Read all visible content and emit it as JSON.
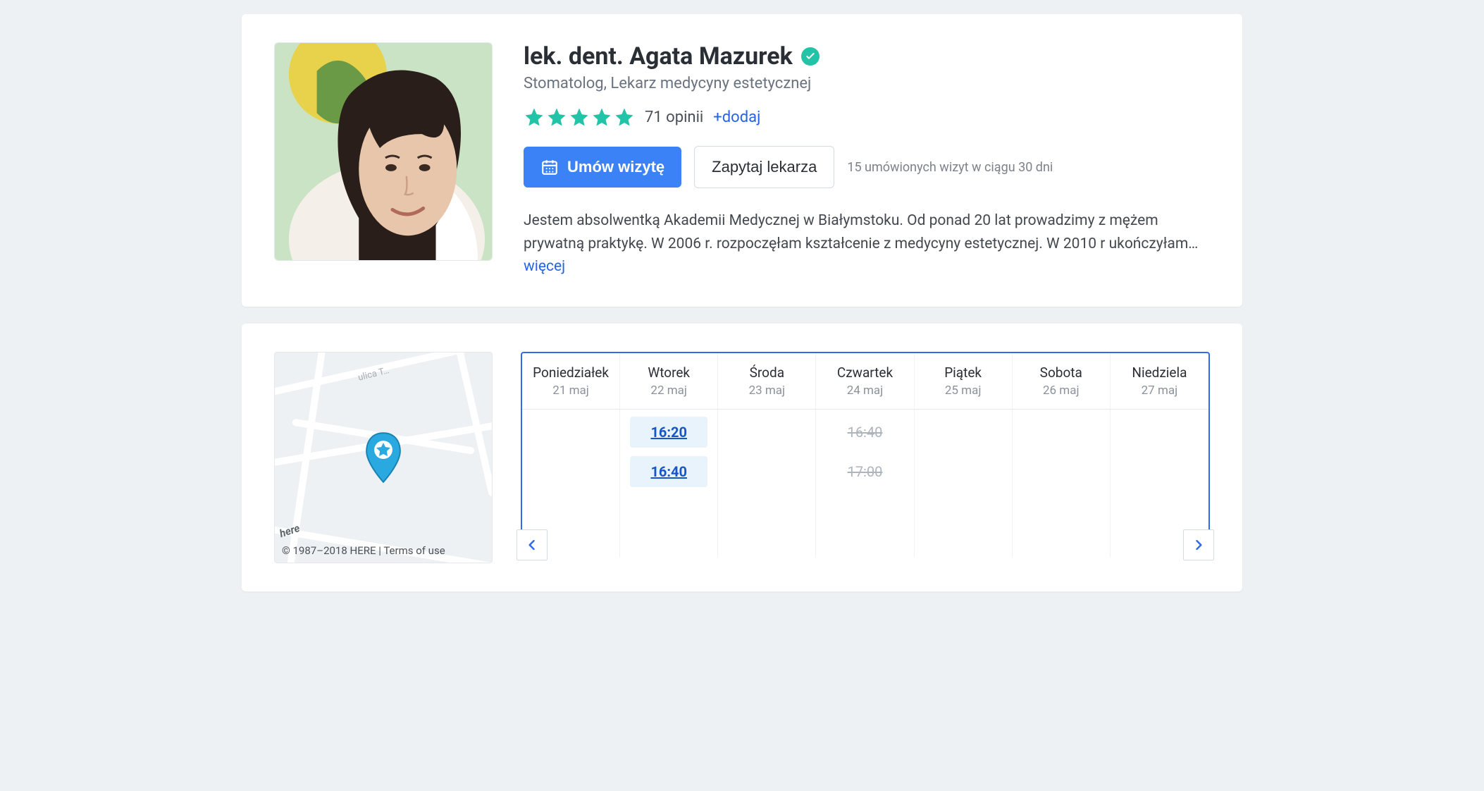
{
  "profile": {
    "name": "lek. dent. Agata Mazurek",
    "specialty": "Stomatolog, Lekarz medycyny estetycznej",
    "reviews_count": "71 opinii",
    "add_review": "+dodaj",
    "book_button": "Umów wizytę",
    "ask_button": "Zapytaj lekarza",
    "visits_note": "15 umówionych wizyt w ciągu 30 dni",
    "bio": "Jestem absolwentką Akademii Medycznej w Białymstoku. Od ponad 20 lat prowadzimy z mężem prywatną praktykę. W 2006 r. rozpoczęłam kształcenie z medycyny estetycznej. W 2010 r ukończyłam…",
    "more": "więcej"
  },
  "map": {
    "brand": "here",
    "attribution": "© 1987–2018 HERE | Terms of use"
  },
  "calendar": {
    "days": [
      {
        "dow": "Poniedziałek",
        "date": "21 maj",
        "slots": []
      },
      {
        "dow": "Wtorek",
        "date": "22 maj",
        "slots": [
          {
            "time": "16:20",
            "available": true
          },
          {
            "time": "16:40",
            "available": true
          }
        ]
      },
      {
        "dow": "Środa",
        "date": "23 maj",
        "slots": []
      },
      {
        "dow": "Czwartek",
        "date": "24 maj",
        "slots": [
          {
            "time": "16:40",
            "available": false
          },
          {
            "time": "17:00",
            "available": false
          }
        ]
      },
      {
        "dow": "Piątek",
        "date": "25 maj",
        "slots": []
      },
      {
        "dow": "Sobota",
        "date": "26 maj",
        "slots": []
      },
      {
        "dow": "Niedziela",
        "date": "27 maj",
        "slots": []
      }
    ]
  }
}
